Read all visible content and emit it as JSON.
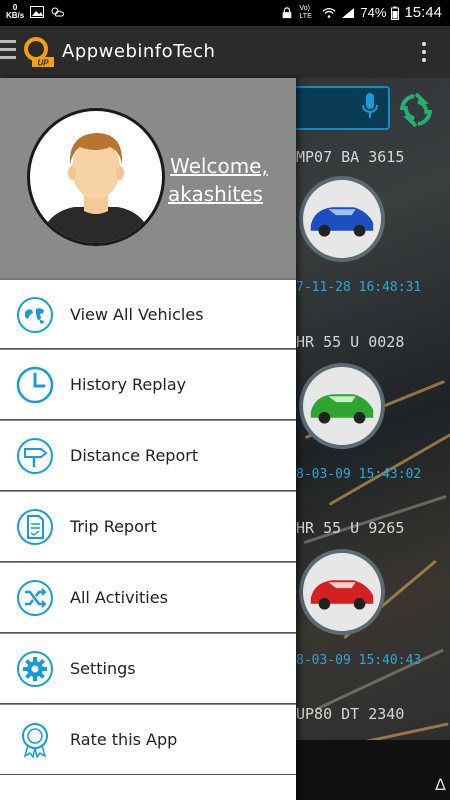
{
  "status_bar": {
    "speed": "0",
    "speed_unit": "KB/s",
    "battery": "74%",
    "time": "15:44",
    "network": "Vo) LTE"
  },
  "app_bar": {
    "title": "AppwebinfoTech",
    "logo_badge": "UP"
  },
  "drawer": {
    "welcome": "Welcome,",
    "username": "akashites",
    "items": [
      {
        "label": "View All Vehicles",
        "icon": "world-map-icon"
      },
      {
        "label": "History Replay",
        "icon": "clock-icon"
      },
      {
        "label": "Distance Report",
        "icon": "signpost-icon"
      },
      {
        "label": "Trip Report",
        "icon": "document-icon"
      },
      {
        "label": "All Activities",
        "icon": "shuffle-icon"
      },
      {
        "label": "Settings",
        "icon": "gear-icon"
      },
      {
        "label": "Rate this App",
        "icon": "award-icon"
      }
    ]
  },
  "vehicles": [
    {
      "id": "MP07 BA 3615",
      "time": "7-11-28 16:48:31",
      "color": "#1e4fc0"
    },
    {
      "id": "HR 55 U 0028",
      "time": "8-03-09 15:43:02",
      "color": "#2fa52f"
    },
    {
      "id": "HR 55 U 9265",
      "time": "8-03-09 15:40:43",
      "color": "#d42020"
    },
    {
      "id": "UP80 DT 2340",
      "time": "",
      "color": "#1e4fc0"
    }
  ],
  "colors": {
    "accent": "#1a9bd7",
    "header_gray": "#8a8a8a",
    "appbar": "#2b2b2b"
  }
}
